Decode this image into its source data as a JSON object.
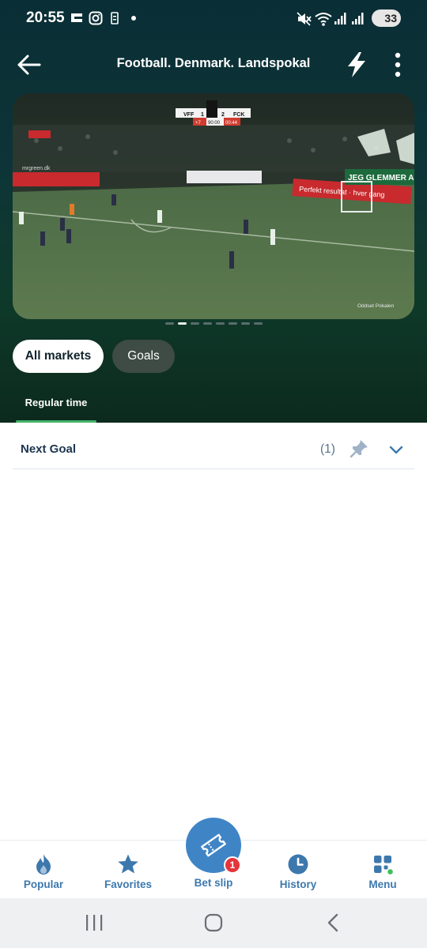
{
  "status_bar": {
    "time": "20:55",
    "battery": "33",
    "icons": [
      "gallery-icon",
      "instagram-icon",
      "sim-icon",
      "dot-icon",
      "mute-icon",
      "wifi-icon",
      "signal-icon",
      "signal-icon",
      "battery-icon"
    ]
  },
  "header": {
    "title": "Football. Denmark. Landspokal",
    "back_icon": "arrow-left-icon",
    "bolt_icon": "lightning-icon",
    "more_icon": "more-vertical-icon"
  },
  "video": {
    "scoreboard": {
      "home": "VFF",
      "home_score": "1",
      "away_score": "2",
      "away": "FCK",
      "added": "+7",
      "clock": "90:00",
      "extra_clock": "00:44"
    },
    "ads": [
      "mrgreen.dk",
      "Perfekt resultat · hver gang",
      "JEG GLEMMER ALD"
    ],
    "watermark": "Oddset Pokalen"
  },
  "carousel": {
    "dots": 8,
    "active_index": 1
  },
  "market_tabs": [
    {
      "label": "All markets",
      "selected": true
    },
    {
      "label": "Goals",
      "selected": false
    }
  ],
  "period_tab": {
    "label": "Regular time"
  },
  "markets": [
    {
      "name": "Next Goal",
      "count": "(1)"
    }
  ],
  "bottom_nav": {
    "items": [
      {
        "label": "Popular",
        "icon": "flame-icon"
      },
      {
        "label": "Favorites",
        "icon": "star-icon"
      },
      {
        "label": "Bet slip",
        "icon": "ticket-icon",
        "badge": "1"
      },
      {
        "label": "History",
        "icon": "clock-icon"
      },
      {
        "label": "Menu",
        "icon": "grid-icon"
      }
    ]
  },
  "colors": {
    "header_bg": "#0a2e36",
    "accent_green": "#46b36a",
    "nav_blue": "#3d78ad",
    "badge_red": "#e5343a"
  }
}
